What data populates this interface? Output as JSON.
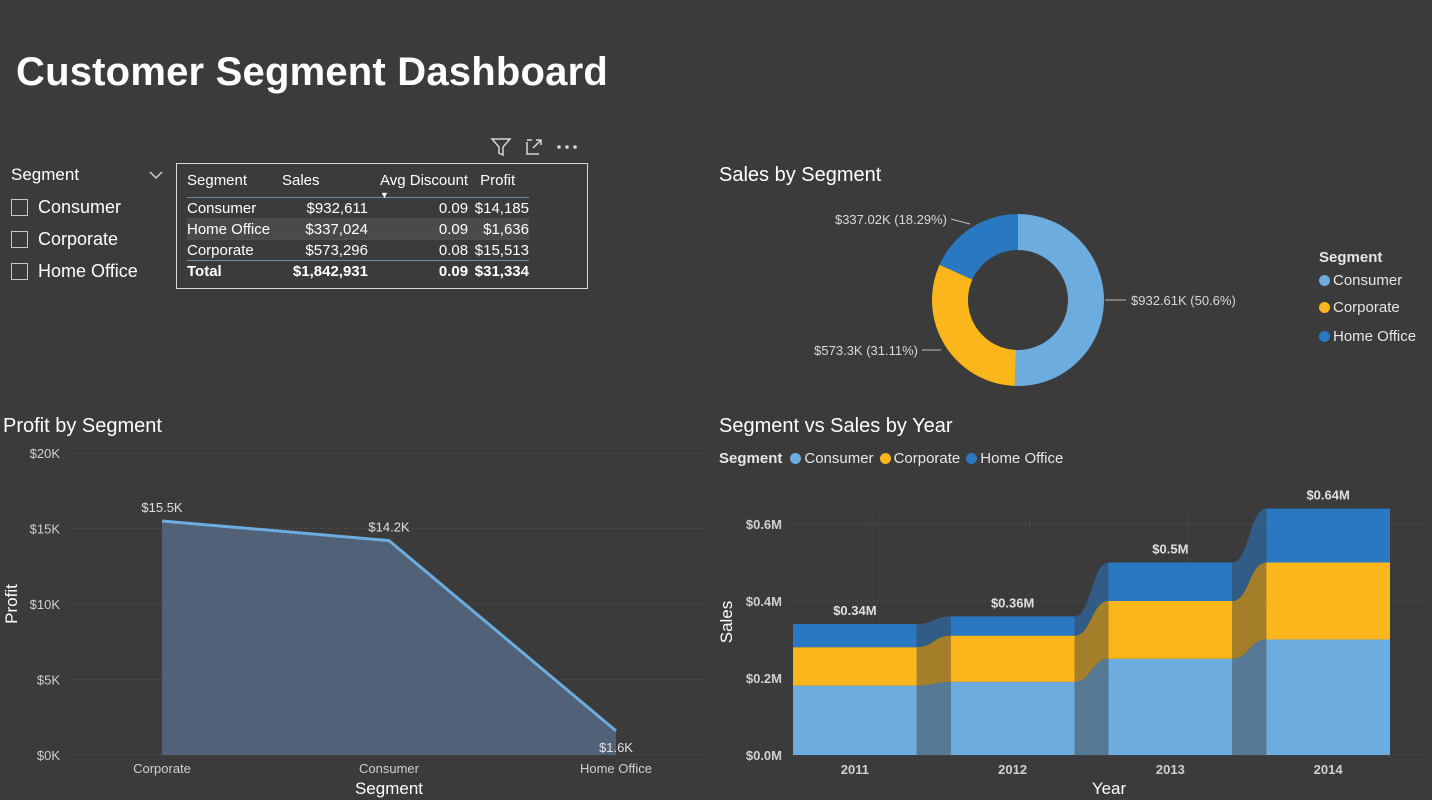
{
  "page": {
    "title": "Customer Segment Dashboard"
  },
  "slicer": {
    "title": "Segment",
    "items": [
      "Consumer",
      "Corporate",
      "Home Office"
    ]
  },
  "table": {
    "columns": [
      "Segment",
      "Sales",
      "Avg Discount",
      "Profit"
    ],
    "rows": [
      [
        "Consumer",
        "$932,611",
        "0.09",
        "$14,185"
      ],
      [
        "Home Office",
        "$337,024",
        "0.09",
        "$1,636"
      ],
      [
        "Corporate",
        "$573,296",
        "0.08",
        "$15,513"
      ]
    ],
    "total": [
      "Total",
      "$1,842,931",
      "0.09",
      "$31,334"
    ]
  },
  "colors": {
    "consumer": "#6cacdf",
    "corporate": "#fbb61c",
    "home_office": "#2a78c2",
    "area_line": "#6cacdf",
    "area_fill": "#52637a"
  },
  "donut": {
    "title": "Sales by Segment",
    "legend_title": "Segment",
    "legend": [
      "Consumer",
      "Corporate",
      "Home Office"
    ],
    "labels": [
      "$932.61K (50.6%)",
      "$573.3K (31.11%)",
      "$337.02K (18.29%)"
    ]
  },
  "profit_chart": {
    "title": "Profit by Segment"
  },
  "ribbon_chart": {
    "title": "Segment vs Sales by Year",
    "legend_title": "Segment",
    "legend": [
      "Consumer",
      "Corporate",
      "Home Office"
    ]
  },
  "chart_data": [
    {
      "type": "pie",
      "title": "Sales by Segment",
      "categories": [
        "Consumer",
        "Corporate",
        "Home Office"
      ],
      "values": [
        932.61,
        573.3,
        337.02
      ],
      "unit": "K",
      "percent": [
        50.6,
        31.11,
        18.29
      ],
      "legend_position": "right"
    },
    {
      "type": "area",
      "title": "Profit by Segment",
      "xlabel": "Segment",
      "ylabel": "Profit",
      "categories": [
        "Corporate",
        "Consumer",
        "Home Office"
      ],
      "values": [
        15.5,
        14.2,
        1.6
      ],
      "data_labels": [
        "$15.5K",
        "$14.2K",
        "$1.6K"
      ],
      "yticks": [
        "$0K",
        "$5K",
        "$10K",
        "$15K",
        "$20K"
      ],
      "ylim": [
        0,
        20
      ],
      "grid": true
    },
    {
      "type": "bar",
      "title": "Segment vs Sales by Year",
      "xlabel": "Year",
      "ylabel": "Sales",
      "categories": [
        "2011",
        "2012",
        "2013",
        "2014"
      ],
      "series": [
        {
          "name": "Consumer",
          "values": [
            0.18,
            0.19,
            0.25,
            0.3
          ]
        },
        {
          "name": "Corporate",
          "values": [
            0.1,
            0.12,
            0.15,
            0.2
          ]
        },
        {
          "name": "Home Office",
          "values": [
            0.06,
            0.05,
            0.1,
            0.14
          ]
        }
      ],
      "totals": [
        "$0.34M",
        "$0.36M",
        "$0.5M",
        "$0.64M"
      ],
      "yticks": [
        "$0.0M",
        "$0.2M",
        "$0.4M",
        "$0.6M"
      ],
      "ylim": [
        0,
        0.6
      ],
      "stacked": true,
      "legend_position": "top-left",
      "grid": true
    }
  ]
}
